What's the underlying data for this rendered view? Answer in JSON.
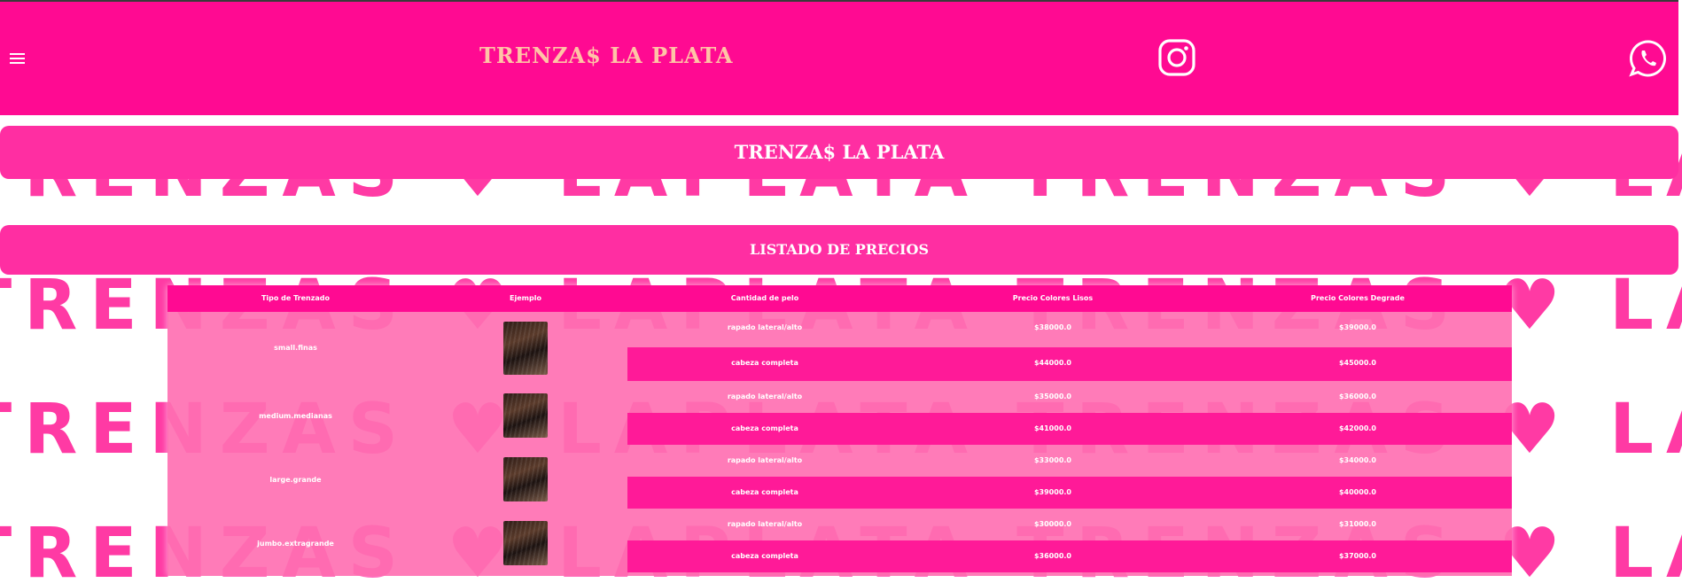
{
  "header": {
    "brand": "TRENZA$ LA PLATA"
  },
  "banners": {
    "title": "TRENZA$ LA PLATA",
    "prices": "LISTADO DE PRECIOS"
  },
  "background_pattern": {
    "text": "TRENZAS ♥ LAPLATA TRENZAS ♥ LAPLATA TRENZAS"
  },
  "table": {
    "headers": [
      "Tipo de Trenzado",
      "Ejemplo",
      "Cantidad de pelo",
      "Precio Colores Lisos",
      "Precio Colores Degrade"
    ],
    "groups": [
      {
        "type": "small.finas",
        "rows": [
          {
            "amount": "rapado lateral/alto",
            "lisos": "$38000.0",
            "degrade": "$39000.0"
          },
          {
            "amount": "cabeza completa",
            "lisos": "$44000.0",
            "degrade": "$45000.0"
          }
        ]
      },
      {
        "type": "medium.medianas",
        "rows": [
          {
            "amount": "rapado lateral/alto",
            "lisos": "$35000.0",
            "degrade": "$36000.0"
          },
          {
            "amount": "cabeza completa",
            "lisos": "$41000.0",
            "degrade": "$42000.0"
          }
        ]
      },
      {
        "type": "large.grande",
        "rows": [
          {
            "amount": "rapado lateral/alto",
            "lisos": "$33000.0",
            "degrade": "$34000.0"
          },
          {
            "amount": "cabeza completa",
            "lisos": "$39000.0",
            "degrade": "$40000.0"
          }
        ]
      },
      {
        "type": "jumbo.extragrande",
        "rows": [
          {
            "amount": "rapado lateral/alto",
            "lisos": "$30000.0",
            "degrade": "$31000.0"
          },
          {
            "amount": "cabeza completa",
            "lisos": "$36000.0",
            "degrade": "$37000.0"
          }
        ]
      }
    ]
  },
  "colors": {
    "primary": "#ff0a92",
    "banner": "#ff2ea2",
    "table_bg": "#ff70b2",
    "brand_text": "#ffc3a6"
  },
  "icons": {
    "menu": "hamburger-icon",
    "instagram": "instagram-icon",
    "whatsapp": "whatsapp-icon"
  }
}
